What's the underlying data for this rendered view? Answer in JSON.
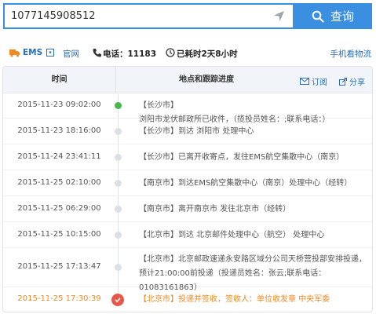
{
  "search": {
    "value": "1077145908512",
    "button_label": "查询"
  },
  "info": {
    "carrier": "EMS",
    "carrier_dropdown": "▾",
    "official_label": "官网",
    "phone": "电话：11183",
    "elapsed": "已耗时2天8小时",
    "mobile_link": "手机看物流"
  },
  "table": {
    "header": {
      "time": "时间",
      "place": "地点和跟踪进度",
      "subscribe": "订阅",
      "share": "分享"
    },
    "rows": [
      {
        "time": "2015-11-23 09:02:00",
        "city": "【长沙市】",
        "text": "浏阳市龙伏邮政所已收件，（揽投员姓名：;联系电话：）"
      },
      {
        "time": "2015-11-23 18:16:00",
        "city": "【长沙市】",
        "text": "到达 浏阳市 处理中心"
      },
      {
        "time": "2015-11-24 23:41:11",
        "city": "【长沙市】",
        "text": "已离开收寄点，发往EMS航空集散中心（南京）"
      },
      {
        "time": "2015-11-25 02:10:00",
        "city": "【南京市】",
        "text": "到达EMS航空集散中心（南京）处理中心（经转）"
      },
      {
        "time": "2015-11-25 06:29:00",
        "city": "【南京市】",
        "text": "离开南京市 发往北京市（经转）"
      },
      {
        "time": "2015-11-25 10:15:00",
        "city": "【北京市】",
        "text": "到达 北京邮件处理中心（航空） 处理中心"
      },
      {
        "time": "2015-11-25 17:13:47",
        "city": "【北京市】",
        "text": "北京邮政速递永安路区域分公司天桥营投部安排投递，预计21:00:00前投递（投递员姓名：张云;联系电话：01083161863）"
      },
      {
        "time": "2015-11-25 17:30:39",
        "city": "【北京市】",
        "text": "投递并签收，签收人：单位收发章 中央军委"
      }
    ]
  },
  "colors": {
    "accent": "#3b8fe0",
    "link": "#2a6fb8",
    "final": "#f08a24",
    "start_dot": "#4bb64b",
    "final_dot": "#e8584a"
  }
}
